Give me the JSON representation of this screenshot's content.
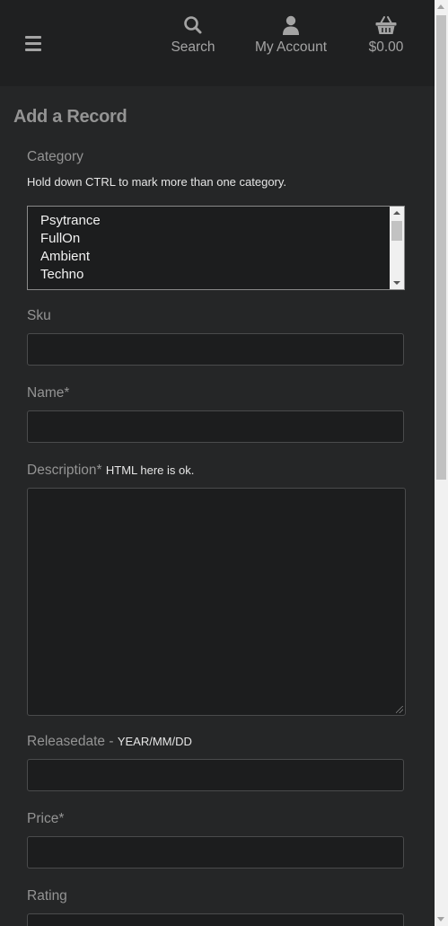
{
  "header": {
    "menu_icon": "hamburger-icon",
    "nav": {
      "search": {
        "label": "Search",
        "icon": "search-icon"
      },
      "account": {
        "label": "My Account",
        "icon": "user-icon"
      },
      "cart": {
        "label": "$0.00",
        "icon": "basket-icon"
      }
    }
  },
  "page": {
    "title": "Add a Record"
  },
  "form": {
    "category": {
      "label": "Category",
      "hint": "Hold down CTRL to mark more than one category.",
      "options": [
        "Psytrance",
        "FullOn",
        "Ambient",
        "Techno"
      ]
    },
    "sku": {
      "label": "Sku",
      "value": ""
    },
    "name": {
      "label": "Name*",
      "value": ""
    },
    "description": {
      "label": "Description*",
      "hint": "HTML here is ok.",
      "value": ""
    },
    "releasedate": {
      "label": "Releasedate -",
      "hint": "YEAR/MM/DD",
      "value": ""
    },
    "price": {
      "label": "Price*",
      "value": ""
    },
    "rating": {
      "label": "Rating",
      "value": ""
    }
  },
  "colors": {
    "page_bg": "#252627",
    "header_bg": "#1f2021",
    "input_bg": "#1c1d1e",
    "label": "#949494",
    "hint": "#e6e6e6"
  }
}
